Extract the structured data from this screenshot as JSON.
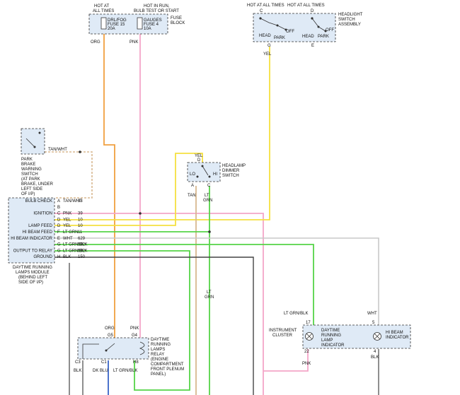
{
  "fuse_block": {
    "hot_left": [
      "HOT AT",
      "ALL TIMES"
    ],
    "hot_right": [
      "HOT IN RUN,",
      "BULB TEST OR START"
    ],
    "fuse1": [
      "DRL/FOG",
      "FUSE 15",
      "20A"
    ],
    "fuse2": [
      "GAUGES",
      "FUSE 4",
      "10A"
    ],
    "name": [
      "FUSE",
      "BLOCK"
    ],
    "wire_left": "ORG",
    "wire_right": "PNK"
  },
  "headlight_switch": {
    "hot_left": "HOT AT ALL TIMES",
    "hot_right": "HOT AT ALL TIMES",
    "pin_c": "C",
    "pin_d": "D",
    "pin_g": "G",
    "pin_e": "E",
    "head1": "HEAD",
    "park1": "PARK",
    "off1": "OFF",
    "head2": "HEAD",
    "park2": "PARK",
    "off2": "OFF",
    "name": [
      "HEADLIGHT",
      "SWITCH",
      "ASSEMBLY"
    ],
    "wire": "YEL"
  },
  "park_brake": {
    "wire": "TAN/WHT",
    "name": [
      "PARK",
      "BRAKE",
      "WARNING",
      "SWITCH",
      "(AT PARK",
      "BRAKE, UNDER",
      "LEFT SIDE",
      "OF I/P)"
    ]
  },
  "dimmer": {
    "wire_in": "YEL",
    "pin_d": "D",
    "lo": "LO",
    "hi": "HI",
    "pin_a": "A",
    "pin_c": "C",
    "name": [
      "HEADLAMP",
      "DIMMER",
      "SWITCH"
    ],
    "wire_a": "TAN",
    "wire_c": [
      "LT",
      "GRN"
    ]
  },
  "drl_module": {
    "rows": [
      {
        "label": "BULB CHECK",
        "pin": "A",
        "wire": "TAN/WHT",
        "circuit": "33"
      },
      {
        "label": "",
        "pin": "B",
        "wire": "",
        "circuit": ""
      },
      {
        "label": "IGNITION",
        "pin": "C",
        "wire": "PNK",
        "circuit": "39"
      },
      {
        "label": "",
        "pin": "D",
        "wire": "YEL",
        "circuit": "10"
      },
      {
        "label": "LAMP FEED",
        "pin": "D",
        "wire": "YEL",
        "circuit": "10"
      },
      {
        "label": "HI BEAM FEED",
        "pin": "F",
        "wire": "LT GRN",
        "circuit": "11"
      },
      {
        "label": "HI BEAM INDICATOR",
        "pin": "E",
        "wire": "WHT",
        "circuit": "629"
      },
      {
        "label": "",
        "pin": "G",
        "wire": "LT GRN/BLK",
        "circuit": "592"
      },
      {
        "label": "OUTPUT TO RELAY",
        "pin": "G",
        "wire": "LT GRN/BLK",
        "circuit": "592"
      },
      {
        "label": "GROUND",
        "pin": "H",
        "wire": "BLK",
        "circuit": "150"
      }
    ],
    "name": [
      "DAYTIME RUNNING",
      "LAMPS MODULE",
      "(BEHIND LEFT",
      "SIDE OF I/P)"
    ]
  },
  "relay": {
    "wire_org": "ORG",
    "wire_pnk": "PNK",
    "pin_g5": "G5",
    "pin_g4": "G4",
    "pin_c3": "C3",
    "pin_c1": "C1",
    "pin_h8": "H8",
    "wire_c3": "BLK",
    "wire_c1": "DK BLU",
    "wire_h8": "LT GRN/BLK",
    "name": [
      "DAYTIME",
      "RUNNING",
      "LAMPS",
      "RELAY",
      "(ENGINE",
      "COMPARTMENT",
      "FRONT PLENUM",
      "PANEL)"
    ]
  },
  "cluster": {
    "name": [
      "INSTRUMENT",
      "CLUSTER"
    ],
    "wire_in1": "LT GRN/BLK",
    "wire_in2": "WHT",
    "pin17": "17",
    "pin5": "5",
    "pin22": "22",
    "pin4": "4",
    "drl_indicator": [
      "DAYTIME",
      "RUNNING",
      "LAMP",
      "INDICATOR"
    ],
    "hi_indicator": [
      "HI BEAM",
      "INDICATOR"
    ],
    "wire_out1": "PNK",
    "wire_out2": "BLK"
  },
  "mid_wire": [
    "LT",
    "GRN"
  ],
  "colors": {
    "org": "#f0a040",
    "pnk": "#f4a6c8",
    "yel": "#f5e040",
    "grn": "#56d448",
    "tan": "#d8b890",
    "wht": "#c8c8c8",
    "blk": "#444444",
    "blu": "#2050c0",
    "box": "#dfeaf6"
  }
}
